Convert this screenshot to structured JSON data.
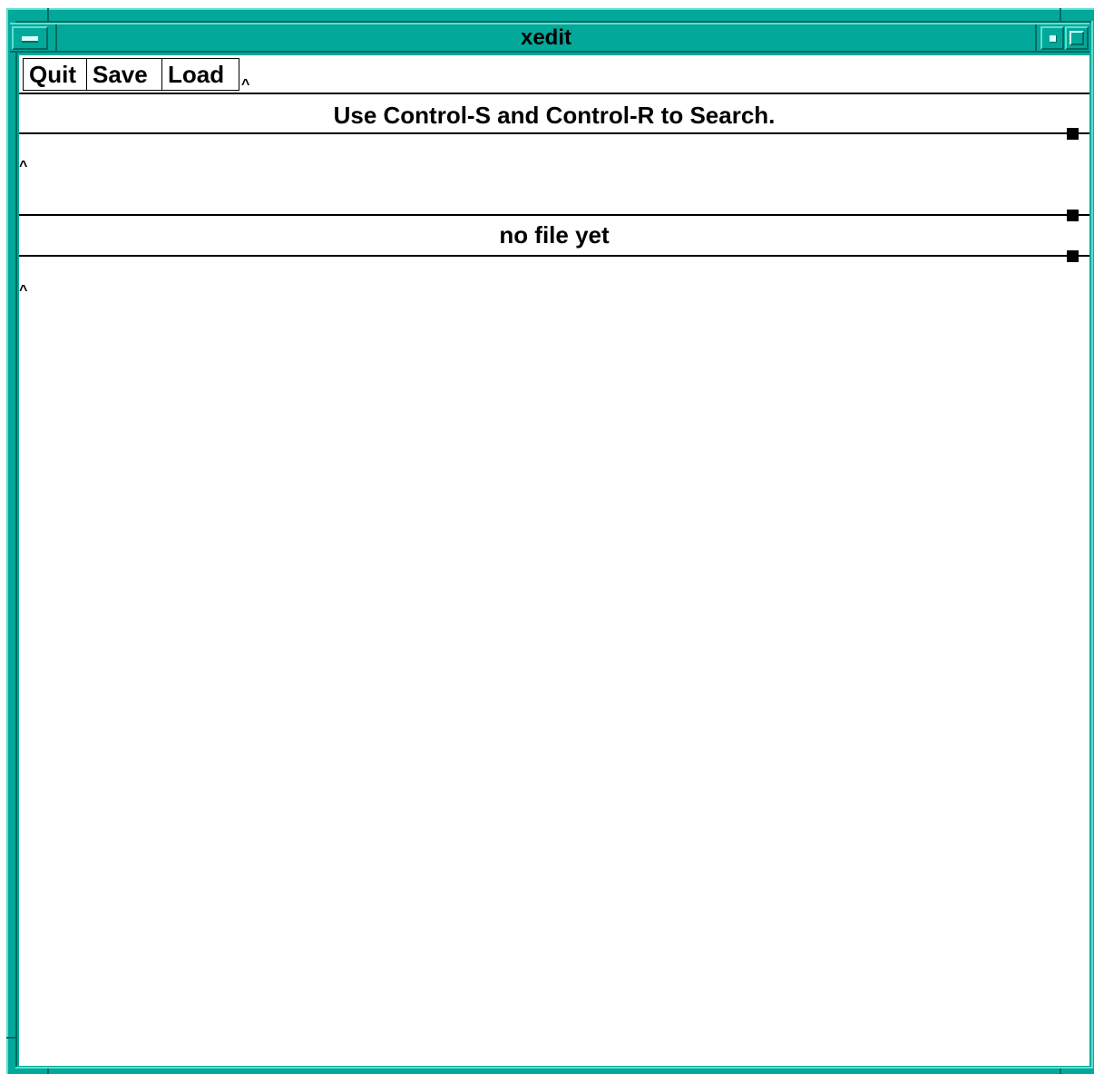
{
  "window": {
    "title": "xedit",
    "frame_color": "#02a99a"
  },
  "icons": {
    "window_menu": "window-menu-icon",
    "minimize": "minimize-icon",
    "maximize": "maximize-icon"
  },
  "buttons": {
    "quit": "Quit",
    "save": "Save",
    "load": "Load"
  },
  "filename_field": {
    "value": "",
    "caret": "^"
  },
  "message": "Use Control-S and Control-R to Search.",
  "message_pane": {
    "caret": "^"
  },
  "file_label": "no file yet",
  "edit_pane": {
    "caret": "^"
  }
}
